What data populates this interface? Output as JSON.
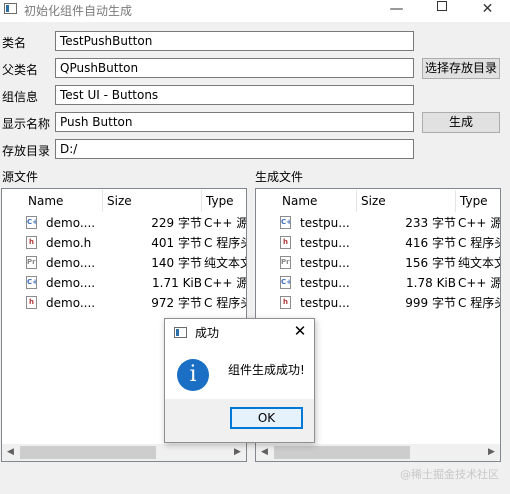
{
  "window": {
    "title": "初始化组件自动生成",
    "min_glyph": "—",
    "close_glyph": "✕"
  },
  "form": {
    "class_name_label": "类名",
    "class_name_value": "TestPushButton",
    "parent_class_label": "父类名",
    "parent_class_value": "QPushButton",
    "group_info_label": "组信息",
    "group_info_value": "Test UI - Buttons",
    "display_name_label": "显示名称",
    "display_name_value": "Push Button",
    "save_dir_label": "存放目录",
    "save_dir_value": "D:/",
    "choose_dir_button": "选择存放目录",
    "generate_button": "生成"
  },
  "source_files": {
    "title": "源文件",
    "columns": [
      "Name",
      "Size",
      "Type"
    ],
    "rows": [
      {
        "icon": "cpp-file-icon",
        "icon_text": "C++",
        "name": "demo....",
        "size": "229 字节",
        "type": "C++ 源"
      },
      {
        "icon": "header-file-icon",
        "icon_text": "h",
        "name": "demo.h",
        "size": "401 字节",
        "type": "C 程序头"
      },
      {
        "icon": "text-file-icon",
        "icon_text": "Pri",
        "name": "demo....",
        "size": "140 字节",
        "type": "纯文本文"
      },
      {
        "icon": "cpp-file-icon",
        "icon_text": "C++",
        "name": "demo....",
        "size": "1.71 KiB",
        "type": "C++ 源"
      },
      {
        "icon": "header-file-icon",
        "icon_text": "h",
        "name": "demo....",
        "size": "972 字节",
        "type": "C 程序头"
      }
    ]
  },
  "generated_files": {
    "title": "生成文件",
    "columns": [
      "Name",
      "Size",
      "Type"
    ],
    "rows": [
      {
        "icon": "cpp-file-icon",
        "icon_text": "C++",
        "name": "testpu...",
        "size": "233 字节",
        "type": "C++ 源"
      },
      {
        "icon": "header-file-icon",
        "icon_text": "h",
        "name": "testpu...",
        "size": "416 字节",
        "type": "C 程序头"
      },
      {
        "icon": "text-file-icon",
        "icon_text": "Pri",
        "name": "testpu...",
        "size": "156 字节",
        "type": "纯文本文"
      },
      {
        "icon": "cpp-file-icon",
        "icon_text": "C++",
        "name": "testpu...",
        "size": "1.78 KiB",
        "type": "C++ 源"
      },
      {
        "icon": "header-file-icon",
        "icon_text": "h",
        "name": "testpu...",
        "size": "999 字节",
        "type": "C 程序头"
      }
    ]
  },
  "dialog": {
    "title": "成功",
    "message": "组件生成成功!",
    "ok_button": "OK",
    "info_glyph": "i",
    "close_glyph": "✕"
  },
  "watermark": "@稀土掘金技术社区",
  "colors": {
    "accent": "#0078d7",
    "info": "#1a6ec4"
  }
}
